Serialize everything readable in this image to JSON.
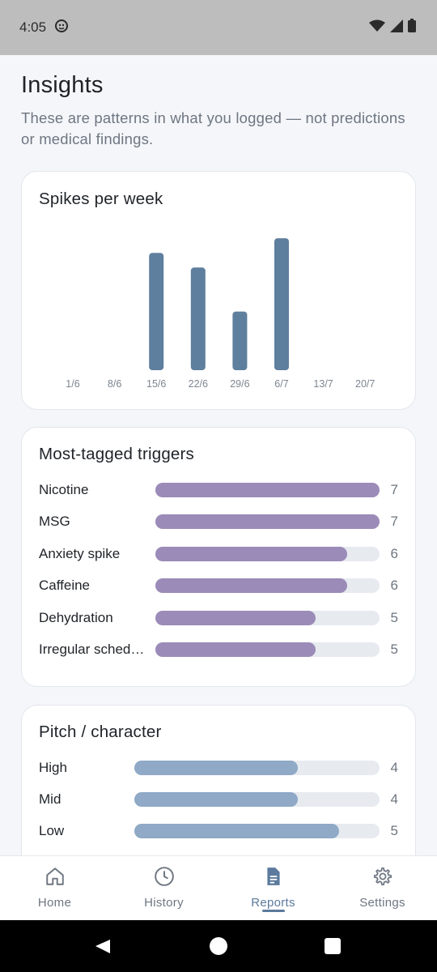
{
  "status_bar": {
    "time": "4:05"
  },
  "header": {
    "title": "Insights",
    "subtitle": "These are patterns in what you logged — not predictions or medical findings."
  },
  "spikes_chart": {
    "title": "Spikes per week",
    "chart_data": {
      "type": "bar",
      "categories": [
        "1/6",
        "8/6",
        "15/6",
        "22/6",
        "29/6",
        "6/7",
        "13/7",
        "20/7"
      ],
      "values": [
        0,
        0,
        8,
        7,
        4,
        9,
        0,
        0
      ],
      "bar_color": "#5e7f9d",
      "grid": false
    }
  },
  "triggers": {
    "title": "Most-tagged triggers",
    "max": 7,
    "color": "#9b8bb8",
    "rows": [
      {
        "label": "Nicotine",
        "value": 7,
        "value_text": "7"
      },
      {
        "label": "MSG",
        "value": 7,
        "value_text": "7"
      },
      {
        "label": "Anxiety spike",
        "value": 6,
        "value_text": "6"
      },
      {
        "label": "Caffeine",
        "value": 6,
        "value_text": "6"
      },
      {
        "label": "Dehydration",
        "value": 5,
        "value_text": "5"
      },
      {
        "label": "Irregular sched…",
        "value": 5,
        "value_text": "5"
      }
    ]
  },
  "pitch": {
    "title": "Pitch / character",
    "max": 6,
    "color": "#8fa9c6",
    "rows": [
      {
        "label": "High",
        "value": 4,
        "value_text": "4"
      },
      {
        "label": "Mid",
        "value": 4,
        "value_text": "4"
      },
      {
        "label": "Low",
        "value": 5,
        "value_text": "5"
      }
    ]
  },
  "nav": {
    "home": "Home",
    "history": "History",
    "reports": "Reports",
    "settings": "Settings",
    "active_color": "#5b7a9d"
  }
}
